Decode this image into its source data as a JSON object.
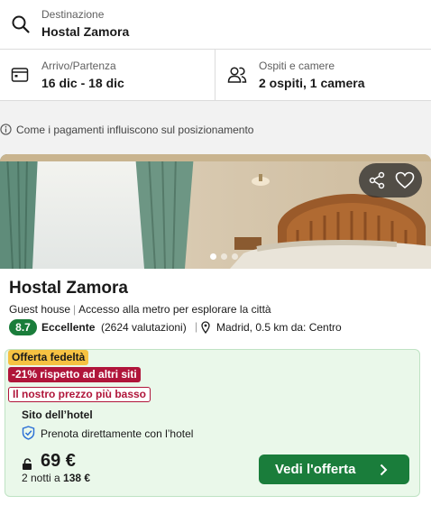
{
  "search": {
    "destination_label": "Destinazione",
    "destination_value": "Hostal Zamora",
    "dates_label": "Arrivo/Partenza",
    "dates_value": "16 dic - 18 dic",
    "guests_label": "Ospiti e camere",
    "guests_value": "2 ospiti, 1 camera"
  },
  "info": {
    "ranking_note": "Come i pagamenti influiscono sul posizionamento"
  },
  "hotel": {
    "name": "Hostal Zamora",
    "type": "Guest house",
    "highlight": "Accesso alla metro per esplorare la città",
    "rating_score": "8.7",
    "rating_word": "Eccellente",
    "rating_count": "(2624 valutazioni)",
    "location": "Madrid, 0.5 km da: Centro",
    "image_dots": 3,
    "active_dot": 0
  },
  "offer": {
    "tag_loyalty": "Offerta fedeltà",
    "tag_discount": "-21% rispetto ad altri siti",
    "tag_best_price": "Il nostro prezzo più basso",
    "site": "Sito dell’hotel",
    "direct_booking": "Prenota direttamente con l’hotel",
    "price": "69 €",
    "nights_text": "2 notti a",
    "total": "138 €",
    "cta_label": "Vedi l'offerta"
  },
  "colors": {
    "accent_green": "#1a7d3b",
    "loyalty_yellow": "#f6c242",
    "discount_red": "#b0153a",
    "offer_bg": "#eaf8ea",
    "shield_blue": "#2a6fd6"
  },
  "icons": {
    "destination": "search-icon",
    "dates": "calendar-icon",
    "guests": "people-icon",
    "info": "info-icon",
    "share": "share-icon",
    "favorite": "heart-icon",
    "location": "pin-icon",
    "direct": "shield-check-icon",
    "price": "lock-icon",
    "cta": "chevron-right-icon"
  }
}
